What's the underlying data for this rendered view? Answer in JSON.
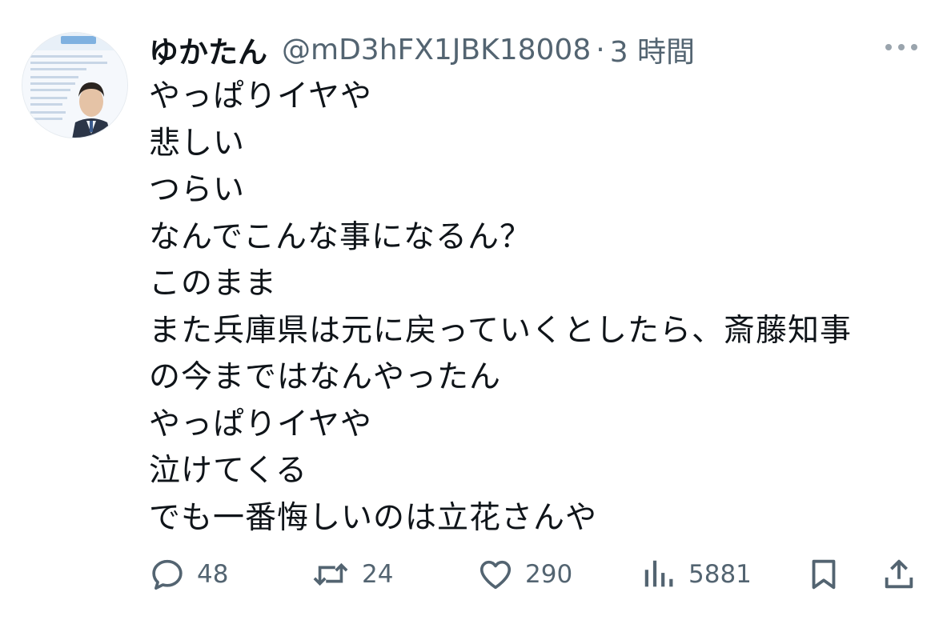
{
  "tweet": {
    "display_name": "ゆかたん",
    "handle": "@mD3hFX1JBK18008",
    "separator": "·",
    "time": "3 時間",
    "lines": [
      "やっぱりイヤや",
      "悲しい",
      "つらい",
      "なんでこんな事になるん？",
      "このまま",
      "また兵庫県は元に戻っていくとしたら、斎藤知事",
      "の今まではなんやったん",
      "やっぱりイヤや",
      "泣けてくる",
      "でも一番悔しいのは立花さんや"
    ],
    "actions": {
      "reply_count": "48",
      "retweet_count": "24",
      "like_count": "290",
      "view_count": "5881"
    }
  },
  "icons": {
    "reply": "reply-icon",
    "retweet": "retweet-icon",
    "like": "heart-icon",
    "views": "views-icon",
    "bookmark": "bookmark-icon",
    "share": "share-icon",
    "more": "more-icon"
  },
  "colors": {
    "text": "#0f1419",
    "secondary": "#536471"
  }
}
